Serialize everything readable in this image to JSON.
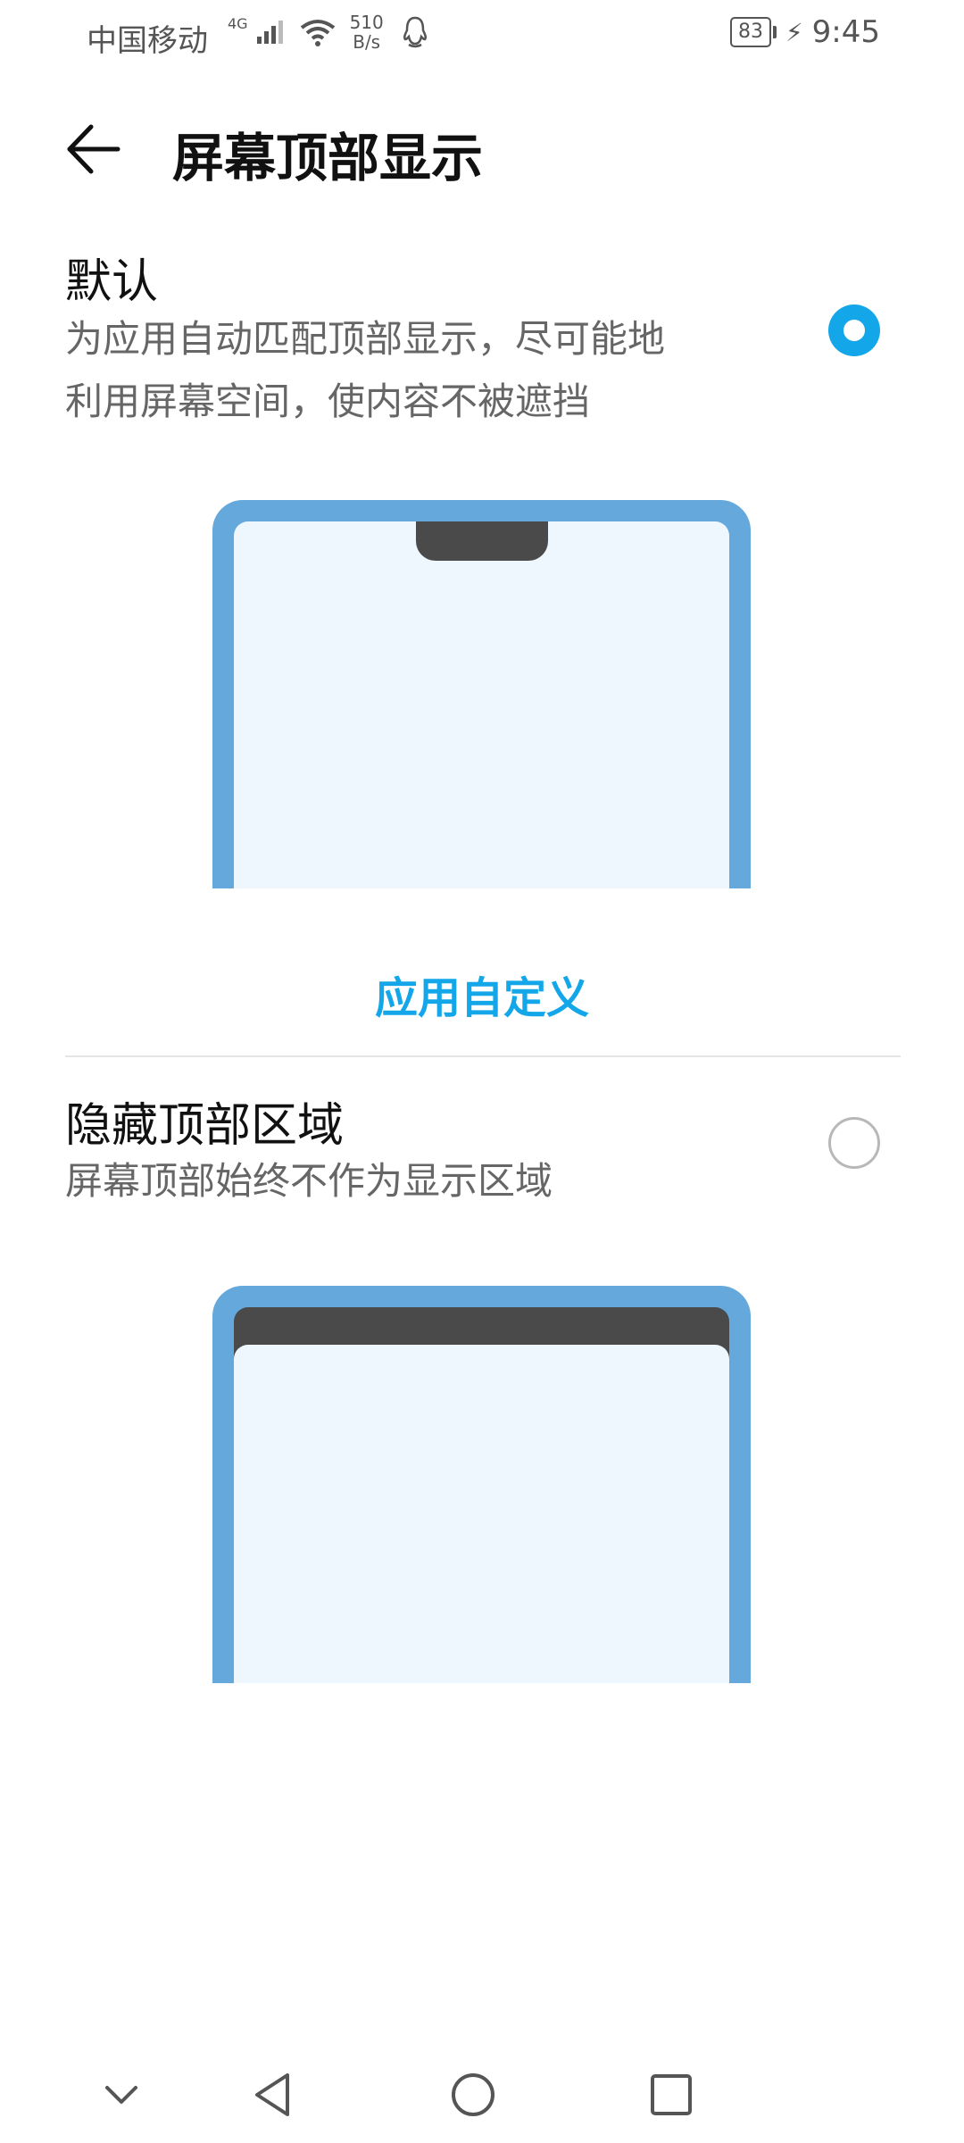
{
  "status_bar": {
    "carrier": "中国移动",
    "network_type": "4G",
    "speed_value": "510",
    "speed_unit": "B/s",
    "battery": "83",
    "time": "9:45"
  },
  "header": {
    "title": "屏幕顶部显示"
  },
  "options": [
    {
      "title": "默认",
      "description_line1": "为应用自动匹配顶部显示，尽可能地",
      "description_line2": "利用屏幕空间，使内容不被遮挡",
      "selected": true
    },
    {
      "title": "隐藏顶部区域",
      "description_line1": "屏幕顶部始终不作为显示区域",
      "selected": false
    }
  ],
  "custom_link": "应用自定义",
  "colors": {
    "accent": "#13a7e9",
    "phone_frame": "#64a8dc",
    "phone_screen": "#eef7fd",
    "notch": "#4a4a4a"
  },
  "nav_bar": {
    "icons": [
      "chevron-down-icon",
      "back-triangle-icon",
      "home-circle-icon",
      "recents-square-icon"
    ]
  }
}
